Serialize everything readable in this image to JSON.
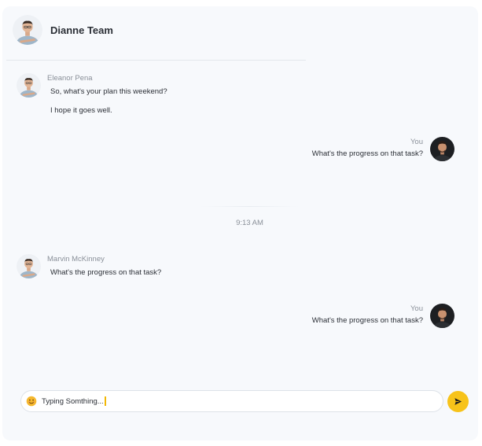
{
  "chat": {
    "title": "Dianne Team"
  },
  "messages": [
    {
      "sender": "Eleanor Pena",
      "lines": [
        "So, what's your plan this weekend?",
        "I hope it goes well."
      ]
    },
    {
      "sender": "You",
      "text": "What's the progress on that task?"
    },
    {
      "timestamp": "9:13 AM"
    },
    {
      "sender": "Marvin McKinney",
      "text": "What's the progress on that task?"
    },
    {
      "sender": "You",
      "text": "What's the progress on that task?"
    }
  ],
  "composer": {
    "value": "Typing Somthing...",
    "emoji_icon": "smile-emoji-icon",
    "send_icon": "send-arrow-icon"
  },
  "colors": {
    "accent": "#f7c31a",
    "background": "#f7f9fc"
  }
}
